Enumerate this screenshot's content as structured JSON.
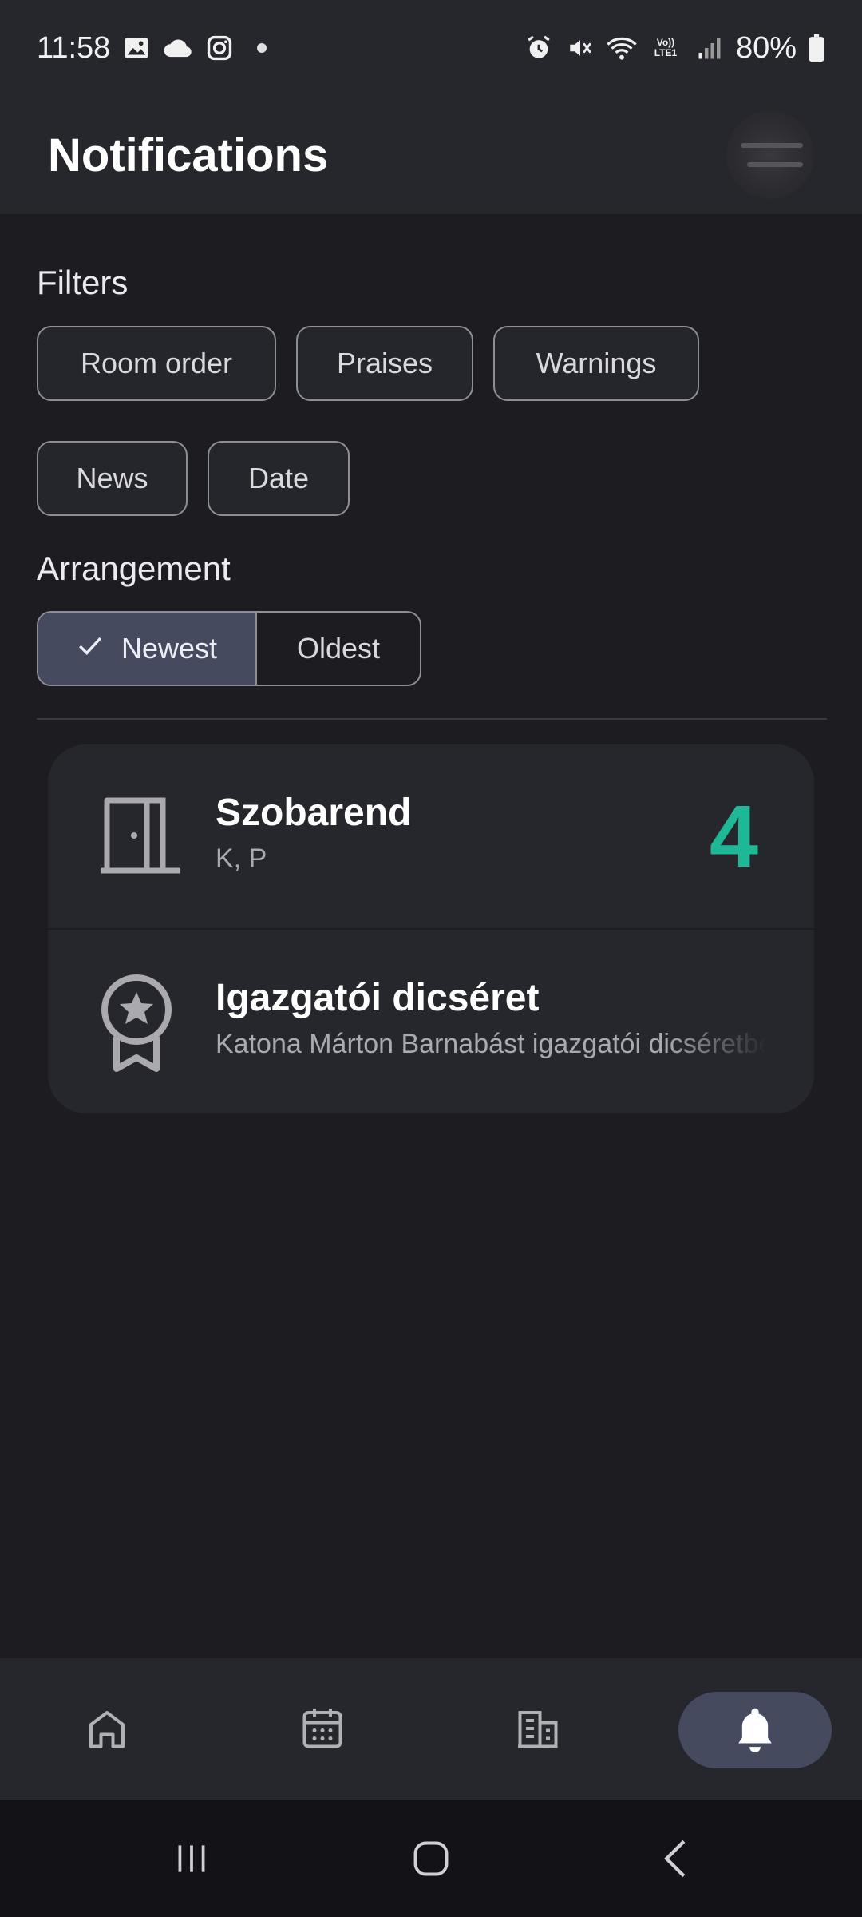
{
  "status_bar": {
    "time": "11:58",
    "battery": "80%",
    "left_icons": [
      "gallery-icon",
      "cloud-icon",
      "instagram-icon",
      "dot-icon"
    ],
    "right_icons": [
      "alarm-icon",
      "mute-icon",
      "wifi-icon",
      "volte-icon",
      "signal-icon",
      "battery-icon"
    ],
    "volte_label": "Vo)) LTE1"
  },
  "header": {
    "title": "Notifications"
  },
  "filters": {
    "label": "Filters",
    "chips": [
      "Room order",
      "Praises",
      "Warnings",
      "News",
      "Date"
    ]
  },
  "arrangement": {
    "label": "Arrangement",
    "options": [
      "Newest",
      "Oldest"
    ],
    "selected": "Newest"
  },
  "notifications": [
    {
      "icon": "door-icon",
      "title": "Szobarend",
      "subtitle": "K, P",
      "count": "4"
    },
    {
      "icon": "award-ribbon-icon",
      "title": "Igazgatói dicséret",
      "subtitle": "Katona Márton Barnabást igazgatói dicséretben részesítem"
    }
  ],
  "bottom_nav": {
    "items": [
      "home-icon",
      "calendar-icon",
      "building-icon",
      "bell-icon"
    ],
    "active": "bell-icon"
  },
  "system_nav": [
    "recents-icon",
    "home-circle-icon",
    "back-icon"
  ],
  "colors": {
    "background": "#1c1c21",
    "surface": "#26272d",
    "accent_count": "#1fb896",
    "active_pill": "#454a5f"
  }
}
